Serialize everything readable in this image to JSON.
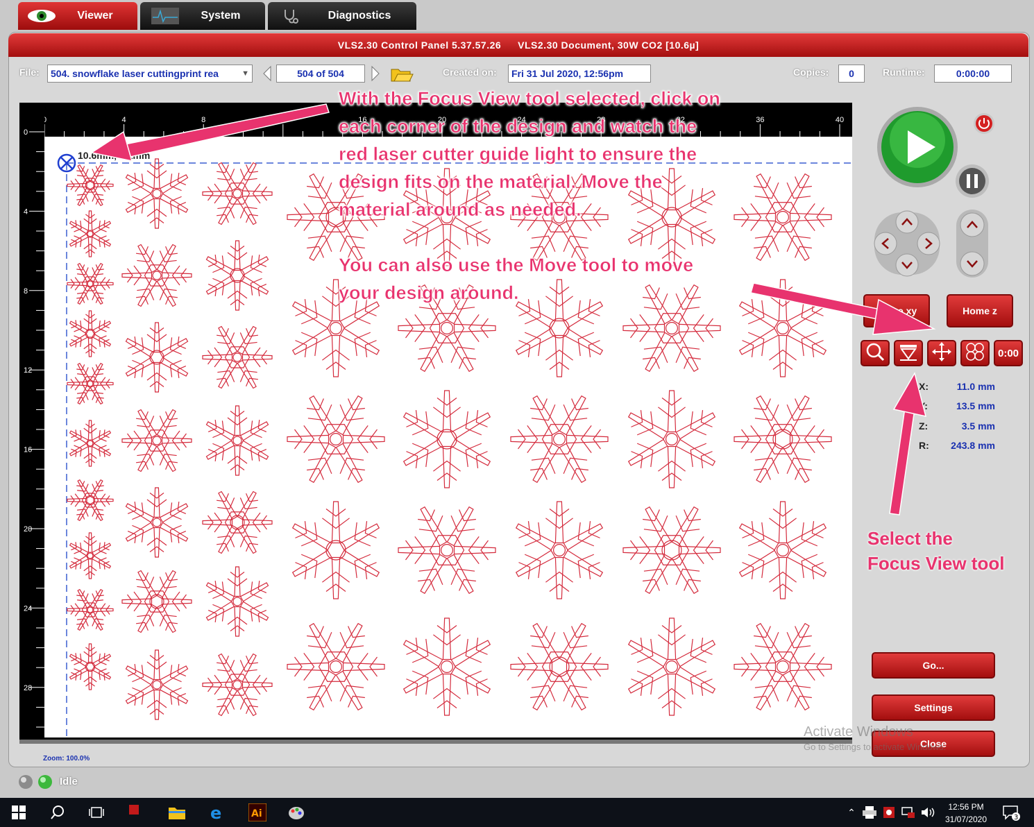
{
  "tabs": [
    {
      "label": "Viewer",
      "active": true
    },
    {
      "label": "System",
      "active": false
    },
    {
      "label": "Diagnostics",
      "active": false
    }
  ],
  "title_bar": {
    "left": "VLS2.30  Control Panel   5.37.57.26",
    "right": "VLS2.30 Document, 30W CO2 [10.6µ]"
  },
  "file_bar": {
    "file_label": "File:",
    "file_value": "504. snowflake laser cuttingprint rea",
    "page_value": "504 of 504",
    "created_label": "Created on:",
    "created_value": "Fri 31 Jul 2020, 12:56pm",
    "copies_label": "Copies:",
    "copies_value": "0",
    "runtime_label": "Runtime:",
    "runtime_value": "0:00:00"
  },
  "ruler": {
    "h_ticks": [
      "0",
      "4",
      "8",
      "12",
      "16",
      "20",
      "24",
      "28",
      "32",
      "36",
      "40"
    ],
    "v_ticks": [
      "0",
      "4",
      "8",
      "12",
      "16",
      "20",
      "24",
      "28"
    ]
  },
  "canvas": {
    "cursor_readout": "10.6mm, 4.1mm",
    "zoom_label": "Zoom:",
    "zoom_value": "100.0%"
  },
  "right_panel": {
    "home_xy_label": "Home xy",
    "home_z_label": "Home z",
    "coords": [
      {
        "label": "X:",
        "value": "11.0 mm"
      },
      {
        "label": "Y:",
        "value": "13.5 mm"
      },
      {
        "label": "Z:",
        "value": "3.5 mm"
      },
      {
        "label": "R:",
        "value": "243.8 mm"
      }
    ],
    "go_label": "Go...",
    "settings_label": "Settings",
    "close_label": "Close",
    "time_tool_label": "0:00"
  },
  "annotations": {
    "main_lines": [
      "With the Focus View tool selected, click on",
      "each corner of the design and watch the",
      "red laser cutter guide light to ensure the",
      "design fits on the material. Move the",
      "material around as needed."
    ],
    "move_lines": [
      "You can also use the Move tool to move",
      "your design around."
    ],
    "focus_lines": [
      "Select the",
      "Focus View tool"
    ]
  },
  "watermark": {
    "line1": "Activate Windows",
    "line2": "Go to Settings to activate Windows."
  },
  "status": {
    "text": "Idle"
  },
  "taskbar": {
    "time": "12:56 PM",
    "date": "31/07/2020",
    "notification_count": "3"
  },
  "colors": {
    "accent_red": "#c21a1a",
    "design_red": "#d42a3c",
    "annotation_pink": "#e8336e",
    "value_blue": "#1a31b0"
  }
}
